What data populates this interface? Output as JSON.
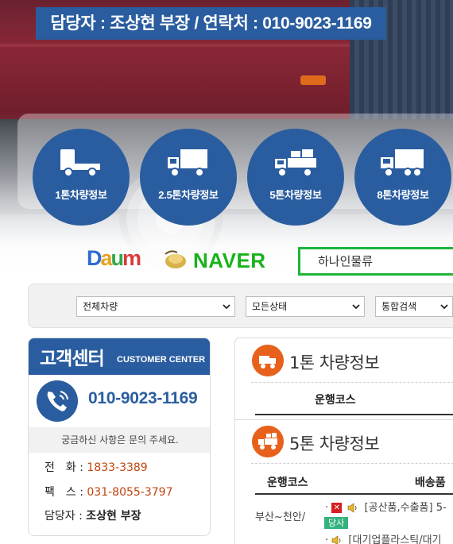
{
  "header": {
    "contact": "담당자 : 조상현 부장 / 연락처 : 010-9023-1169"
  },
  "vehicle_buttons": [
    {
      "label": "1톤차량정보",
      "icon": "small-truck-icon"
    },
    {
      "label": "2.5톤차량정보",
      "icon": "box-truck-icon"
    },
    {
      "label": "5톤차량정보",
      "icon": "cargo-truck-icon"
    },
    {
      "label": "8톤차량정보",
      "icon": "large-truck-icon"
    }
  ],
  "search": {
    "daum_logo": "Daum",
    "naver_logo": "NAVER",
    "query": "하나인물류"
  },
  "filters": {
    "vehicle_select": "전체차량",
    "status_select": "모든상태",
    "search_type_select": "통합검색"
  },
  "customer_center": {
    "title": "고객센터",
    "subtitle": "CUSTOMER CENTER",
    "phone": "010-9023-1169",
    "note": "궁금하신 사항은 문의 주세요.",
    "tel_label": "전　화 :",
    "tel_value": "1833-3389",
    "fax_label": "팩　스 :",
    "fax_value": "031-8055-3797",
    "manager_label": "담당자 :",
    "manager_value": "조상현 부장"
  },
  "vehicle_info": {
    "one_ton": {
      "title": "1톤 차량정보",
      "col_route": "운행코스"
    },
    "five_ton": {
      "title": "5톤 차량정보",
      "col_route": "운행코스",
      "col_delivery": "배송품",
      "rows": [
        {
          "route": "부산~천안/",
          "item": "[공산품,수출품] 5-",
          "tag": "당사"
        },
        {
          "route": "",
          "item": "[대기업플라스틱/대기"
        }
      ]
    }
  },
  "colors": {
    "brand_blue": "#2a5d9f",
    "accent_orange": "#e8611c",
    "naver_green": "#19b21b",
    "tag_green": "#33b27e",
    "phone_red": "#c1440e"
  }
}
